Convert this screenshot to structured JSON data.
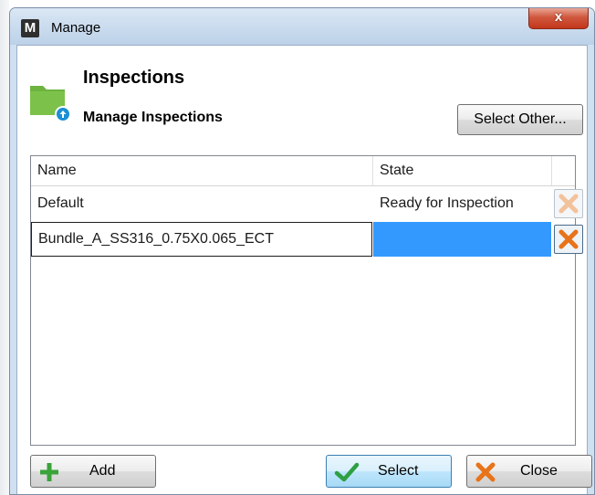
{
  "window": {
    "title": "Manage",
    "app_icon_letter": "M",
    "close_glyph": "x"
  },
  "header": {
    "title": "Inspections",
    "subtitle": "Manage Inspections",
    "icon": "folder-upload-icon",
    "select_other_label": "Select Other..."
  },
  "table": {
    "columns": [
      "Name",
      "State"
    ],
    "rows": [
      {
        "name": "Default",
        "state": "Ready for Inspection",
        "delete_enabled": false
      },
      {
        "name": "Bundle_A_SS316_0.75X0.065_ECT",
        "state": "",
        "delete_enabled": true,
        "editing": true,
        "selected": true
      }
    ]
  },
  "footer": {
    "add_label": "Add",
    "select_label": "Select",
    "close_label": "Close"
  },
  "colors": {
    "accent_selection": "#3399ff",
    "folder_green": "#6db33f",
    "delete_orange": "#e8731a",
    "check_green": "#2ea043"
  }
}
